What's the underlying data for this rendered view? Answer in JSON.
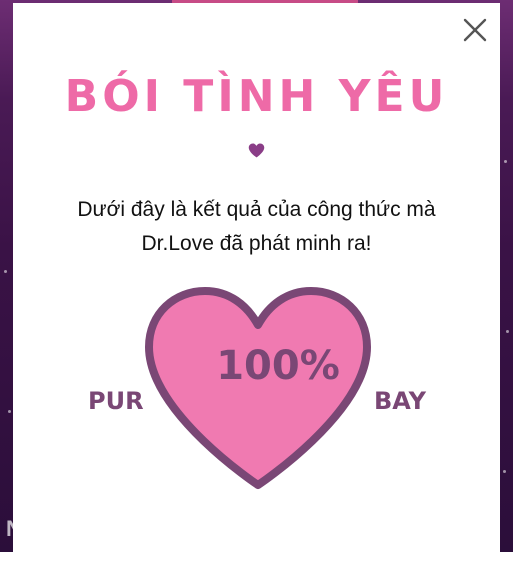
{
  "modal": {
    "title": "BÓI TÌNH YÊU",
    "subtitle_line1": "Dưới đây là kết quả của công thức mà",
    "subtitle_line2": "Dr.Love đã phát minh ra!",
    "percent": "100%",
    "name_left": "PUR",
    "name_right": "BAY",
    "close_icon": "close-icon",
    "heart_icon": "heart-icon"
  },
  "colors": {
    "title_pink": "#ee6aa7",
    "heart_fill": "#f07ab1",
    "heart_stroke": "#7a4775",
    "name_purple": "#7a4775",
    "small_heart": "#8a3d87"
  }
}
